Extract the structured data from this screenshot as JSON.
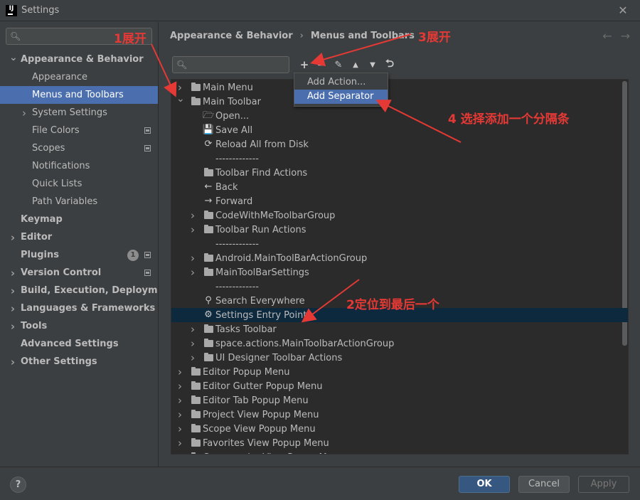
{
  "window": {
    "title": "Settings"
  },
  "sidebar": {
    "search_value": "",
    "items": [
      {
        "label": "Appearance & Behavior",
        "level": 0,
        "arrow": "down",
        "bold": true
      },
      {
        "label": "Appearance",
        "level": 1
      },
      {
        "label": "Menus and Toolbars",
        "level": 1,
        "selected": true
      },
      {
        "label": "System Settings",
        "level": 1,
        "arrow": "right"
      },
      {
        "label": "File Colors",
        "level": 1,
        "project_icon": true
      },
      {
        "label": "Scopes",
        "level": 1,
        "project_icon": true
      },
      {
        "label": "Notifications",
        "level": 1
      },
      {
        "label": "Quick Lists",
        "level": 1
      },
      {
        "label": "Path Variables",
        "level": 1
      },
      {
        "label": "Keymap",
        "level": 0,
        "bold": true
      },
      {
        "label": "Editor",
        "level": 0,
        "arrow": "right",
        "bold": true
      },
      {
        "label": "Plugins",
        "level": 0,
        "bold": true,
        "badge": "1",
        "project_icon": true
      },
      {
        "label": "Version Control",
        "level": 0,
        "arrow": "right",
        "bold": true,
        "project_icon": true
      },
      {
        "label": "Build, Execution, Deployment",
        "level": 0,
        "arrow": "right",
        "bold": true
      },
      {
        "label": "Languages & Frameworks",
        "level": 0,
        "arrow": "right",
        "bold": true
      },
      {
        "label": "Tools",
        "level": 0,
        "arrow": "right",
        "bold": true
      },
      {
        "label": "Advanced Settings",
        "level": 0,
        "bold": true
      },
      {
        "label": "Other Settings",
        "level": 0,
        "arrow": "right",
        "bold": true
      }
    ]
  },
  "breadcrumb": {
    "parent": "Appearance & Behavior",
    "separator": "›",
    "current": "Menus and Toolbars"
  },
  "toolbar": {
    "search_value": "",
    "buttons": [
      {
        "name": "add-button",
        "glyph": "+"
      },
      {
        "name": "remove-button",
        "glyph": "−"
      },
      {
        "name": "edit-button",
        "glyph": "✎"
      },
      {
        "name": "move-up-button",
        "glyph": "▲"
      },
      {
        "name": "move-down-button",
        "glyph": "▼"
      },
      {
        "name": "restore-button",
        "glyph": "⮌"
      }
    ]
  },
  "popup": {
    "items": [
      "Add Action...",
      "Add Separator"
    ],
    "selected_index": 1
  },
  "tree": [
    {
      "label": "Main Menu",
      "level": 0,
      "arrow": "right",
      "icon": "folder"
    },
    {
      "label": "Main Toolbar",
      "level": 0,
      "arrow": "down",
      "icon": "folder"
    },
    {
      "label": "Open...",
      "level": 1,
      "icon": "open-folder"
    },
    {
      "label": "Save All",
      "level": 1,
      "icon": "save"
    },
    {
      "label": "Reload All from Disk",
      "level": 1,
      "icon": "reload"
    },
    {
      "label": "-------------",
      "level": 1,
      "icon": "none"
    },
    {
      "label": "Toolbar Find Actions",
      "level": 1,
      "icon": "folder"
    },
    {
      "label": "Back",
      "level": 1,
      "icon": "back"
    },
    {
      "label": "Forward",
      "level": 1,
      "icon": "forward"
    },
    {
      "label": "CodeWithMeToolbarGroup",
      "level": 1,
      "arrow": "right",
      "icon": "folder"
    },
    {
      "label": "Toolbar Run Actions",
      "level": 1,
      "arrow": "right",
      "icon": "folder"
    },
    {
      "label": "-------------",
      "level": 1,
      "icon": "none"
    },
    {
      "label": "Android.MainToolBarActionGroup",
      "level": 1,
      "arrow": "right",
      "icon": "folder"
    },
    {
      "label": "MainToolBarSettings",
      "level": 1,
      "arrow": "right",
      "icon": "folder"
    },
    {
      "label": "-------------",
      "level": 1,
      "icon": "none"
    },
    {
      "label": "Search Everywhere",
      "level": 1,
      "icon": "search"
    },
    {
      "label": "Settings Entry Point",
      "level": 1,
      "icon": "gear",
      "selected": true
    },
    {
      "label": "Tasks Toolbar",
      "level": 1,
      "arrow": "right",
      "icon": "folder"
    },
    {
      "label": "space.actions.MainToolbarActionGroup",
      "level": 1,
      "arrow": "right",
      "icon": "folder"
    },
    {
      "label": "UI Designer Toolbar Actions",
      "level": 1,
      "arrow": "right",
      "icon": "folder"
    },
    {
      "label": "Editor Popup Menu",
      "level": 0,
      "arrow": "right",
      "icon": "folder"
    },
    {
      "label": "Editor Gutter Popup Menu",
      "level": 0,
      "arrow": "right",
      "icon": "folder"
    },
    {
      "label": "Editor Tab Popup Menu",
      "level": 0,
      "arrow": "right",
      "icon": "folder"
    },
    {
      "label": "Project View Popup Menu",
      "level": 0,
      "arrow": "right",
      "icon": "folder"
    },
    {
      "label": "Scope View Popup Menu",
      "level": 0,
      "arrow": "right",
      "icon": "folder"
    },
    {
      "label": "Favorites View Popup Menu",
      "level": 0,
      "arrow": "right",
      "icon": "folder"
    },
    {
      "label": "Commander View Popup Menu",
      "level": 0,
      "arrow": "right",
      "icon": "folder"
    }
  ],
  "footer": {
    "help": "?",
    "ok": "OK",
    "cancel": "Cancel",
    "apply": "Apply"
  },
  "annotations": {
    "a1": "1展开",
    "a2": "2定位到最后一个",
    "a3": "3展开",
    "a4": "4  选择添加一个分隔条"
  },
  "colors": {
    "accent": "#4b6eaf",
    "annotation": "#e53935",
    "tree_selection": "#0d293e"
  }
}
